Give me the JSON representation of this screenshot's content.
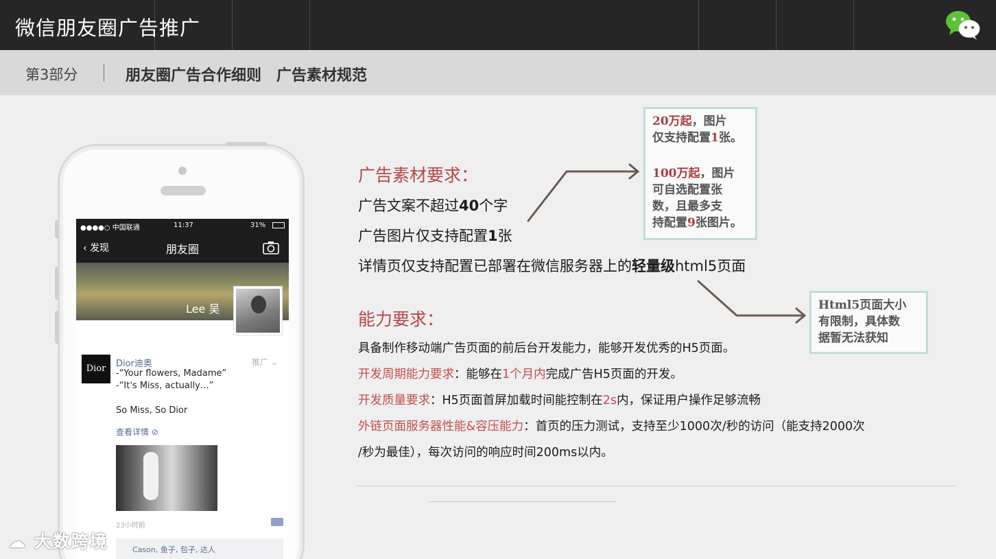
{
  "header": {
    "title": "微信朋友圈广告推广",
    "logo_icon": "wechat-logo-icon"
  },
  "section": {
    "part": "第3部分",
    "heading": "朋友圈广告合作细则　广告素材规范"
  },
  "phone": {
    "status": {
      "carrier": "●●●●○ 中国联通",
      "time": "11:37",
      "battery": "31%"
    },
    "nav": {
      "back": "发现",
      "title": "朋友圈"
    },
    "cover_name": "Lee 吴",
    "ad": {
      "logo": "Dior",
      "name": "Dior迪奥",
      "tag": "推广",
      "lines": [
        "-“Your flowers, Madame”",
        "-“It's Miss, actually…”",
        "So Miss, So Dior"
      ],
      "detail_link": "查看详情",
      "time": "23小时前",
      "likes": "Cason, 鱼子, 包子, 达人"
    }
  },
  "material": {
    "heading": "广告素材要求：",
    "line1_pre": "广告文案不超过",
    "line1_bold": "40",
    "line1_post": "个字",
    "line2_pre": "广告图片仅支持配置",
    "line2_bold": "1",
    "line2_post": "张",
    "line3_pre": "详情页仅支持配置已部署在微信服务器上的",
    "line3_bold": "轻量级",
    "line3_post": "html5页面"
  },
  "callout_pricing": {
    "a_red": "20万起",
    "a_text": "，图片",
    "b_pre": "仅支持配置",
    "b_red": "1",
    "b_post": "张。",
    "c_red": "100万起",
    "c_text": "，图片",
    "d_text": "可自选配置张",
    "e_text": "数，且最多支",
    "f_pre": "持配置",
    "f_red": "9",
    "f_post": "张图片。"
  },
  "callout_html5": {
    "l1": "Html5页面大小",
    "l2": "有限制，具体数",
    "l3": "据暂无法获知"
  },
  "ability": {
    "heading": "能力要求：",
    "line1": "具备制作移动端广告页面的前后台开发能力，能够开发优秀的H5页面。",
    "line2_label": "开发周期能力要求",
    "line2_a": "：能够在",
    "line2_red": "1个月内",
    "line2_b": "完成广告H5页面的开发。",
    "line3_label": "开发质量要求",
    "line3_a": "：H5页面首屏加载时间能控制在",
    "line3_red": "2s",
    "line3_b": "内，保证用户操作足够流畅",
    "line4_label": "外链页面服务器性能&容压能力",
    "line4_a": "：首页的压力测试，支持至少1000次/秒的访问（能支持2000次",
    "line5": "/秒为最佳），每次访问的响应时间200ms以内。"
  },
  "watermark": "大数跨境",
  "colors": {
    "topbar": "#262626",
    "section_bar": "#d9d9d9",
    "accent_red": "#b24848",
    "callout_border": "#bfdcd8",
    "arrow": "#6b5a50"
  }
}
